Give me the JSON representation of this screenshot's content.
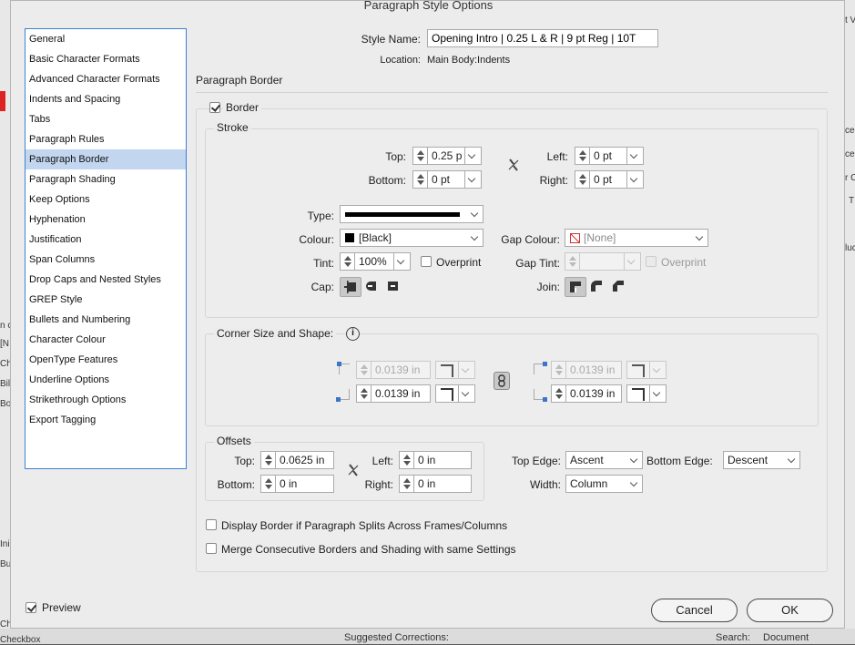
{
  "dialog_title": "Paragraph Style Options",
  "sidebar": {
    "items": [
      "General",
      "Basic Character Formats",
      "Advanced Character Formats",
      "Indents and Spacing",
      "Tabs",
      "Paragraph Rules",
      "Paragraph Border",
      "Paragraph Shading",
      "Keep Options",
      "Hyphenation",
      "Justification",
      "Span Columns",
      "Drop Caps and Nested Styles",
      "GREP Style",
      "Bullets and Numbering",
      "Character Colour",
      "OpenType Features",
      "Underline Options",
      "Strikethrough Options",
      "Export Tagging"
    ],
    "active": "Paragraph Border"
  },
  "style_name": {
    "label": "Style Name:",
    "value": "Opening Intro | 0.25 L & R | 9 pt Reg | 10T"
  },
  "location": {
    "label": "Location:",
    "value": "Main Body:Indents"
  },
  "section_heading": "Paragraph Border",
  "border": {
    "label": "Border",
    "checked": true
  },
  "stroke": {
    "title": "Stroke",
    "top_label": "Top:",
    "top_value": "0.25 p",
    "bottom_label": "Bottom:",
    "bottom_value": "0 pt",
    "left_label": "Left:",
    "left_value": "0 pt",
    "right_label": "Right:",
    "right_value": "0 pt",
    "type_label": "Type:",
    "colour_label": "Colour:",
    "colour_value": "[Black]",
    "colour_swatch": "#000000",
    "gap_colour_label": "Gap Colour:",
    "gap_colour_value": "[None]",
    "tint_label": "Tint:",
    "tint_value": "100%",
    "overprint_label": "Overprint",
    "gap_tint_label": "Gap Tint:",
    "gap_overprint_label": "Overprint",
    "cap_label": "Cap:",
    "join_label": "Join:"
  },
  "corner": {
    "title": "Corner Size and Shape:",
    "top_left": "0.0139 in",
    "bottom_left": "0.0139 in",
    "top_right": "0.0139 in",
    "bottom_right": "0.0139 in"
  },
  "offsets": {
    "title": "Offsets",
    "top_label": "Top:",
    "top_value": "0.0625 in",
    "bottom_label": "Bottom:",
    "bottom_value": "0 in",
    "left_label": "Left:",
    "left_value": "0 in",
    "right_label": "Right:",
    "right_value": "0 in"
  },
  "edges": {
    "top_edge_label": "Top Edge:",
    "top_edge_value": "Ascent",
    "bottom_edge_label": "Bottom Edge:",
    "bottom_edge_value": "Descent",
    "width_label": "Width:",
    "width_value": "Column"
  },
  "options": {
    "display_split": "Display Border if Paragraph Splits Across Frames/Columns",
    "merge": "Merge Consecutive Borders and Shading with same Settings"
  },
  "preview": {
    "label": "Preview",
    "checked": true
  },
  "buttons": {
    "cancel": "Cancel",
    "ok": "OK"
  },
  "background_fragments": {
    "left": [
      "n c",
      "[N",
      "Ch",
      "Bil",
      "Bo",
      "Ini",
      "Bu",
      "Ch",
      "Checkbox"
    ],
    "right": [
      "t V",
      "cept",
      "cept",
      "r C",
      "T",
      "luc"
    ],
    "bottom_mid": "Suggested Corrections:",
    "bottom_search": "Search:",
    "bottom_document": "Document"
  }
}
